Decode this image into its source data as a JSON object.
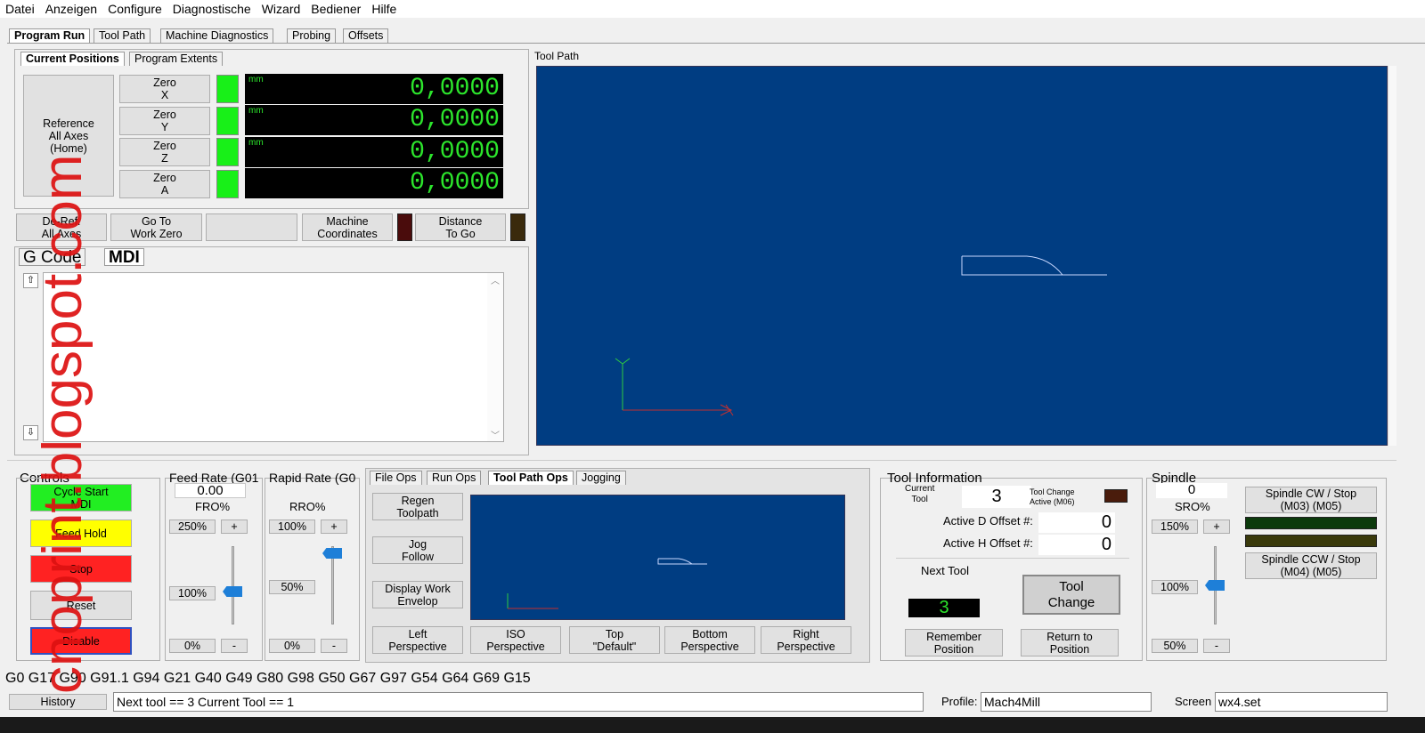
{
  "menu": [
    "Datei",
    "Anzeigen",
    "Configure",
    "Diagnostische",
    "Wizard",
    "Bediener",
    "Hilfe"
  ],
  "main_tabs": [
    "Program Run",
    "Tool Path",
    "Machine Diagnostics",
    "Probing",
    "Offsets"
  ],
  "pos_tabs": [
    "Current Positions",
    "Program Extents"
  ],
  "reference_button": "Reference\nAll Axes\n(Home)",
  "axes": [
    {
      "zero_label": "Zero\nX",
      "unit": "mm",
      "value": "0,0000"
    },
    {
      "zero_label": "Zero\nY",
      "unit": "mm",
      "value": "0,0000"
    },
    {
      "zero_label": "Zero\nZ",
      "unit": "mm",
      "value": "0,0000"
    },
    {
      "zero_label": "Zero\nA",
      "unit": "",
      "value": "0,0000"
    }
  ],
  "pos_buttons": {
    "deref": "De-Ref.\nAll Axes",
    "goto_zero": "Go To\nWork Zero",
    "machine_coords": "Machine\nCoordinates",
    "dist_to_go": "Distance\nTo Go"
  },
  "code_tabs": [
    "G Code",
    "MDI"
  ],
  "toolpath_title": "Tool Path",
  "controls": {
    "title": "Controls",
    "cycle_start": "Cycle Start\nMDI",
    "feed_hold": "Feed Hold",
    "stop": "Stop",
    "reset": "Reset",
    "disable": "Disable"
  },
  "feed_rate": {
    "title": "Feed Rate (G01",
    "value": "0.00",
    "label": "FRO%",
    "max": "250%",
    "plus": "+",
    "current": "100%",
    "min": "0%",
    "minus": "-",
    "level_percent": 100
  },
  "rapid_rate": {
    "title": "Rapid Rate (G0",
    "label": "RRO%",
    "max": "100%",
    "plus": "+",
    "current": "50%",
    "min": "0%",
    "minus": "-",
    "level_percent": 100
  },
  "ops_tabs": [
    "File Ops",
    "Run Ops",
    "Tool Path Ops",
    "Jogging"
  ],
  "ops_buttons": {
    "regen": "Regen\nToolpath",
    "jog_follow": "Jog\nFollow",
    "display_envelope": "Display Work\nEnvelop",
    "left": "Left\nPerspective",
    "iso": "ISO\nPerspective",
    "top": "Top\n\"Default\"",
    "bottom": "Bottom\nPerspective",
    "right": "Right\nPerspective"
  },
  "tool_info": {
    "title": "Tool Information",
    "current_tool_label": "Current\nTool",
    "current_tool": "3",
    "tool_change_active": "Tool Change\nActive (M06)",
    "active_d_label": "Active D Offset #:",
    "active_d": "0",
    "active_h_label": "Active H Offset #:",
    "active_h": "0",
    "next_tool_label": "Next Tool",
    "next_tool": "3",
    "tool_change": "Tool\nChange",
    "remember": "Remember\nPosition",
    "return": "Return to\nPosition"
  },
  "spindle": {
    "title": "Spindle",
    "value": "0",
    "label": "SRO%",
    "max": "150%",
    "plus": "+",
    "current": "100%",
    "min": "50%",
    "minus": "-",
    "cw": "Spindle CW / Stop\n(M03)          (M05)",
    "ccw": "Spindle CCW / Stop\n(M04)          (M05)",
    "level_percent": 100
  },
  "gcodes": "G0 G17 G90 G91.1 G94 G21 G40 G49 G80 G98 G50 G67 G97 G54 G64 G69 G15",
  "status": {
    "history": "History",
    "message": "Next tool == 3   Current Tool == 1",
    "profile_label": "Profile:",
    "profile": "Mach4Mill",
    "screen_label": "Screen",
    "screen": "wx4.set"
  },
  "watermark": "cnoprint.blogspot.com",
  "colors": {
    "dro_text": "#2ce52c",
    "toolpath_bg": "#003d82",
    "led_green": "#18f018",
    "cycle_start": "#22ee22",
    "feed_hold": "#ffff00",
    "stop": "#ff2222"
  }
}
